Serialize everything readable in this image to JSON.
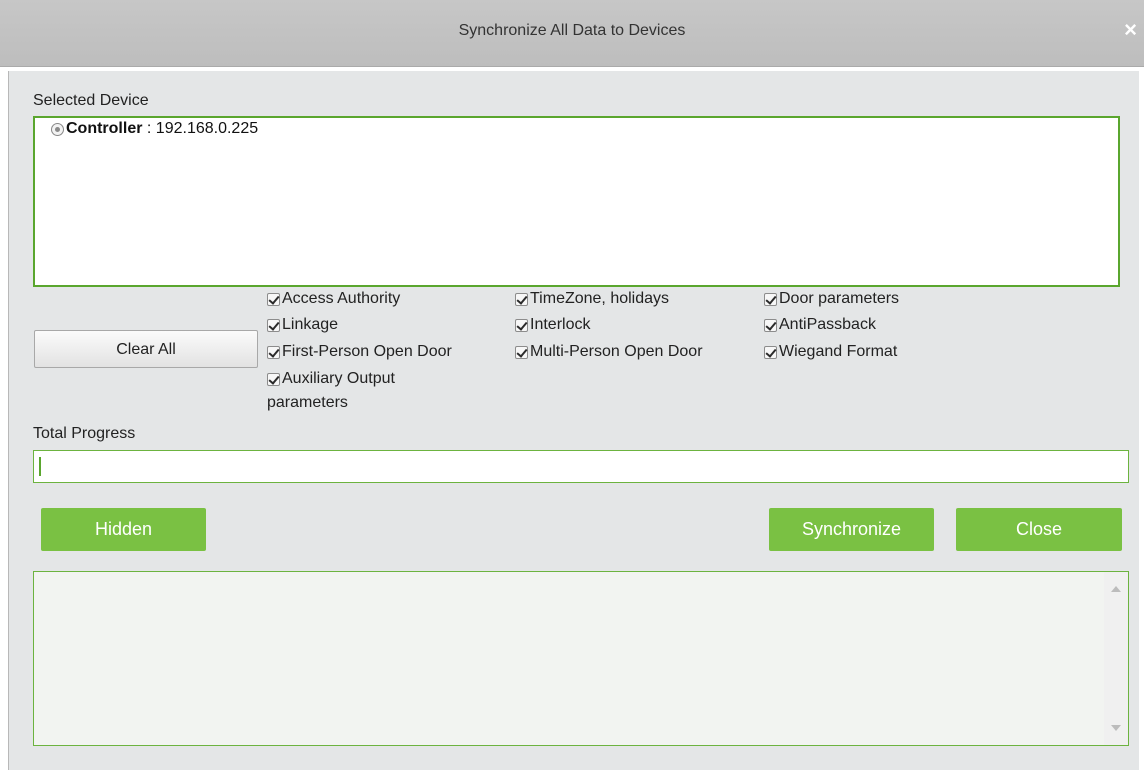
{
  "window": {
    "title": "Synchronize All Data to Devices",
    "close_glyph": "×"
  },
  "selected_device": {
    "label": "Selected Device",
    "devices": [
      {
        "name": "Controller",
        "separator": " : ",
        "address": "192.168.0.225"
      }
    ]
  },
  "clear_all_label": "Clear All",
  "options": [
    {
      "label": "Access Authority",
      "checked": true
    },
    {
      "label": "TimeZone, holidays",
      "checked": true
    },
    {
      "label": "Door parameters",
      "checked": true
    },
    {
      "label": "Linkage",
      "checked": true
    },
    {
      "label": "Interlock",
      "checked": true
    },
    {
      "label": "AntiPassback",
      "checked": true
    },
    {
      "label": "First-Person Open Door",
      "checked": true
    },
    {
      "label": "Multi-Person Open Door",
      "checked": true
    },
    {
      "label": "Wiegand Format",
      "checked": true
    },
    {
      "label": "Auxiliary Output",
      "label_line2": "parameters",
      "checked": true
    }
  ],
  "total_progress": {
    "label": "Total Progress",
    "value_percent": 0
  },
  "buttons": {
    "hidden": "Hidden",
    "synchronize": "Synchronize",
    "close": "Close"
  },
  "log": {
    "content": ""
  },
  "colors": {
    "accent_green": "#7ac143",
    "border_green": "#6cb33f",
    "titlebar_gray": "#c4c4c4",
    "panel_gray": "#e4e6e7"
  },
  "icons": {
    "window_close": "close-icon",
    "scroll_up": "scroll-up-arrow-icon",
    "scroll_down": "scroll-down-arrow-icon"
  }
}
